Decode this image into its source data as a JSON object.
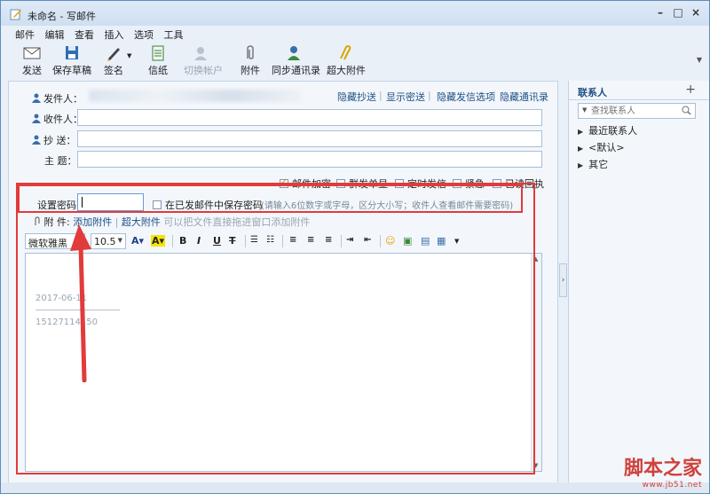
{
  "window": {
    "title": "未命名 - 写邮件"
  },
  "menu": [
    "邮件",
    "编辑",
    "查看",
    "插入",
    "选项",
    "工具"
  ],
  "toolbar": {
    "send": "发送",
    "save_draft": "保存草稿",
    "signature": "签名",
    "stationery": "信纸",
    "switch_account": "切换帐户",
    "attachment": "附件",
    "sync_contacts": "同步通讯录",
    "large_attachment": "超大附件"
  },
  "header": {
    "from_label": "发件人：",
    "to_label": "收件人：",
    "cc_label": "抄  送：",
    "subject_label": "主  题：",
    "links": [
      "隐藏抄送",
      "显示密送",
      "隐藏发信选项",
      "隐藏通讯录"
    ]
  },
  "options": {
    "encrypt": "邮件加密",
    "individual": "群发单显",
    "scheduled": "定时发信",
    "urgent": "紧急",
    "read_receipt": "已读回执",
    "encrypt_checked": true
  },
  "password": {
    "label": "设置密码:",
    "save_label": "在已发邮件中保存密码",
    "hint": "(请输入6位数字或字母，区分大小写；收件人查看邮件需要密码)"
  },
  "attachment_row": {
    "label": "附  件:",
    "add": "添加附件",
    "large": "超大附件",
    "hint": "可以把文件直接拖进窗口添加附件"
  },
  "format": {
    "font": "微软雅黑",
    "size": "10.5",
    "bold": "B",
    "italic": "I",
    "underline": "U",
    "strike": "T"
  },
  "editor": {
    "date": "2017-06-11",
    "phone": "15127114150"
  },
  "contacts": {
    "title": "联系人",
    "add": "+",
    "search_placeholder": "查找联系人",
    "groups": [
      "最近联系人",
      "<默认>",
      "其它"
    ]
  },
  "watermark": {
    "logo": "脚本之家",
    "url": "www.jb51.net"
  },
  "colors": {
    "highlight_red": "#e23b3b",
    "link_blue": "#1f4f84",
    "window_bg": "#e9f0f8"
  }
}
